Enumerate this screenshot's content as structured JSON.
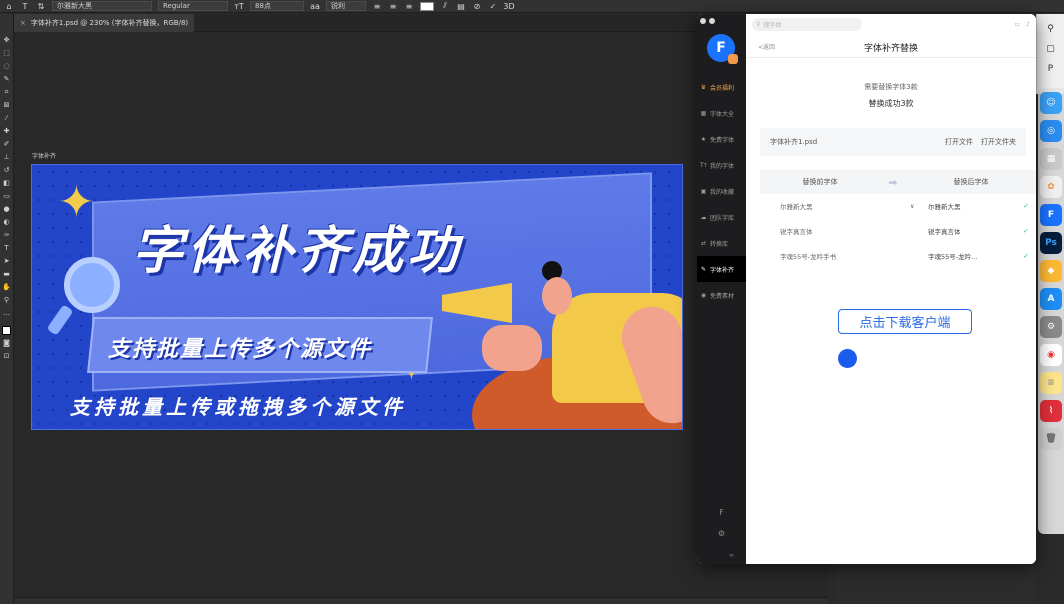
{
  "optbar": {
    "font_family": "尔雅新大黑",
    "font_style": "Regular",
    "font_size": "88点",
    "antialias": "锐利"
  },
  "document": {
    "tab_title": "字体补齐1.psd @ 230% (字体补齐替换，RGB/8)",
    "artboard_label": "字体补齐"
  },
  "banner": {
    "title": "字体补齐成功",
    "subtitle": "支持批量上传多个源文件",
    "tagline": "支持批量上传或拖拽多个源文件"
  },
  "app": {
    "search_placeholder": "搜字体",
    "sidebar": [
      {
        "icon": "crown-icon",
        "label": "会员福利",
        "vip": true
      },
      {
        "icon": "grid-icon",
        "label": "字体大全"
      },
      {
        "icon": "star-icon",
        "label": "免费字体"
      },
      {
        "icon": "font-icon",
        "label": "我的字体"
      },
      {
        "icon": "folder-icon",
        "label": "我的收藏"
      },
      {
        "icon": "team-icon",
        "label": "团队字库"
      },
      {
        "icon": "convert-icon",
        "label": "转换库"
      },
      {
        "icon": "wrench-icon",
        "label": "字体补齐",
        "active": true
      },
      {
        "icon": "image-icon",
        "label": "免费素材"
      }
    ],
    "back_label": "<返回",
    "page_title": "字体补齐替换",
    "needs_replace": "需要替换字体3款",
    "replace_success": "替换成功3款",
    "file_name": "字体补齐1.psd",
    "open_file": "打开文件",
    "open_folder": "打开文件夹",
    "col_before": "替换前字体",
    "col_after": "替换后字体",
    "rows": [
      {
        "before": "尔雅新大黑",
        "after": "尔雅新大黑",
        "dropdown": true
      },
      {
        "before": "锐字真言体",
        "after": "锐字真言体",
        "dropdown": false
      },
      {
        "before": "字魂55号-龙吟手书",
        "after": "字魂55号-龙吟...",
        "dropdown": false
      }
    ],
    "download_button": "点击下载客户端",
    "foot_label": "∞"
  },
  "dock": {
    "apps": [
      "finder-icon",
      "safari-icon",
      "launchpad-icon",
      "photos-icon",
      "fontapp-icon",
      "photoshop-icon",
      "sketch-icon",
      "appstore-icon",
      "settings-icon",
      "chrome-icon",
      "notes-icon",
      "pulse-icon",
      "trash-icon"
    ]
  },
  "colors": {
    "banner_blue": "#2345c9",
    "accent_blue": "#2a6ae6",
    "vip_orange": "#f2a24a",
    "success_green": "#3cc07a"
  }
}
